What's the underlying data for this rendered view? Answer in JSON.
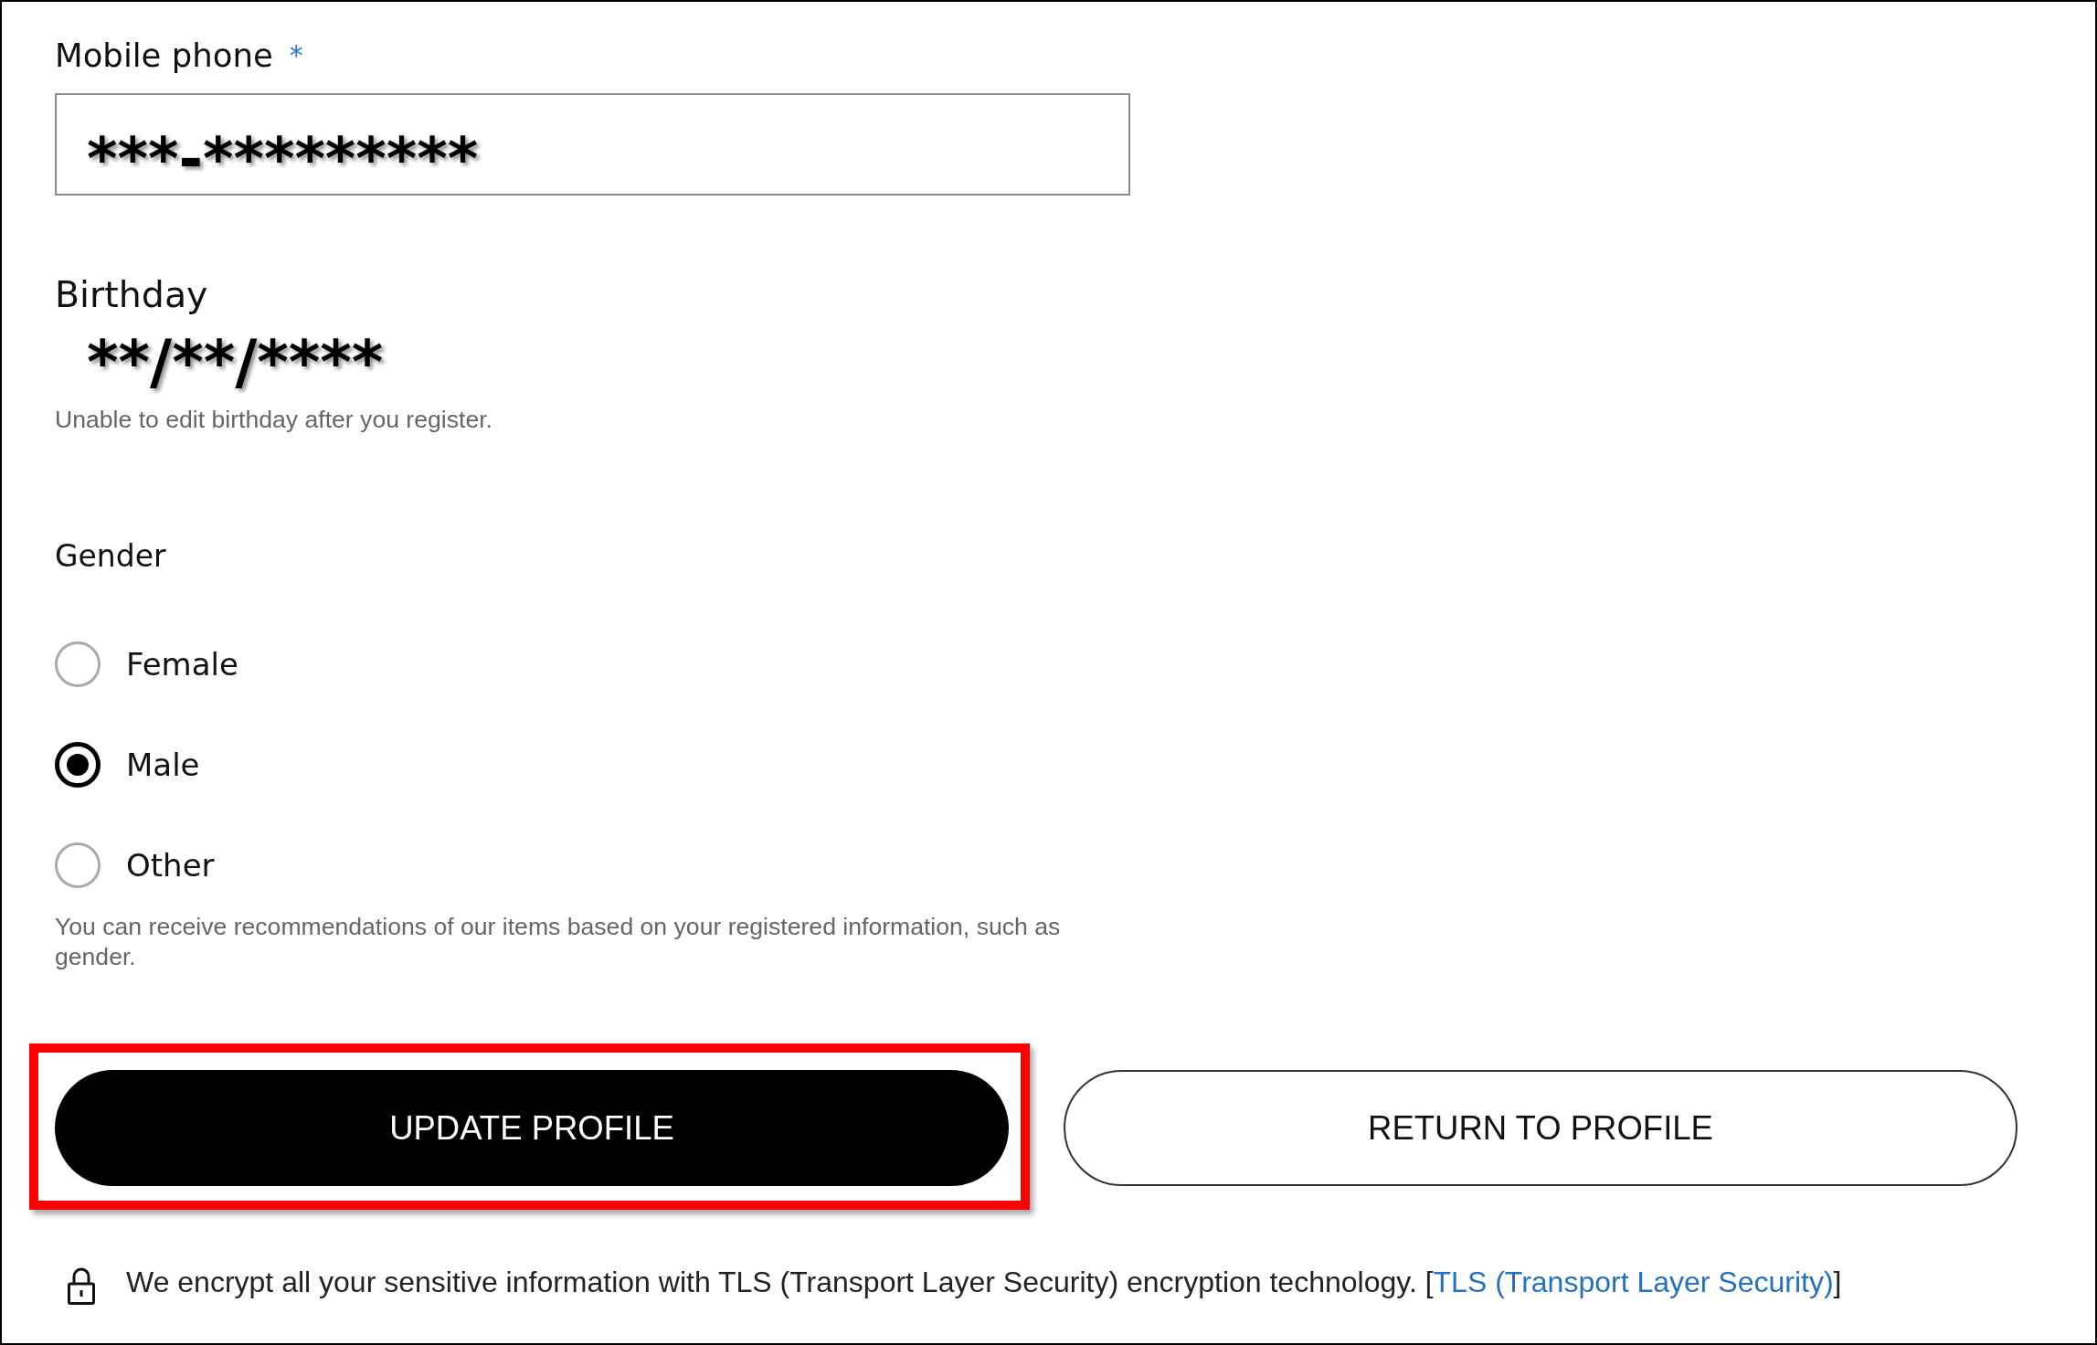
{
  "form": {
    "mobile_phone": {
      "label": "Mobile phone",
      "required_mark": "*",
      "value": "***-*********"
    },
    "birthday": {
      "label": "Birthday",
      "value": "**/**/****",
      "hint": "Unable to edit birthday after you register."
    },
    "gender": {
      "label": "Gender",
      "options": [
        {
          "label": "Female",
          "selected": false
        },
        {
          "label": "Male",
          "selected": true
        },
        {
          "label": "Other",
          "selected": false
        }
      ],
      "hint": "You can receive recommendations of our items based on your registered information, such as gender."
    }
  },
  "buttons": [
    {
      "label": "UPDATE PROFILE",
      "kind": "primary",
      "highlighted": true
    },
    {
      "label": "RETURN TO PROFILE",
      "kind": "secondary",
      "highlighted": false
    }
  ],
  "security_notice": {
    "text": "We encrypt all your sensitive information with TLS (Transport Layer Security) encryption technology. [",
    "link": "TLS (Transport Layer Security)",
    "after": "]"
  }
}
